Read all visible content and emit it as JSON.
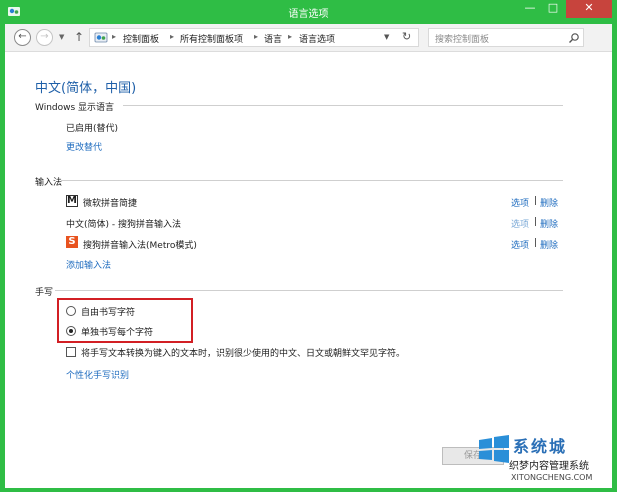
{
  "window": {
    "title": "语言选项",
    "minimize": "—",
    "maximize": "□",
    "close": "✕"
  },
  "address_bar": {
    "breadcrumbs": [
      "控制面板",
      "所有控制面板项",
      "语言",
      "语言选项"
    ],
    "search_placeholder": "搜索控制面板"
  },
  "page": {
    "heading": "中文(简体，中国)",
    "windows_display_language": {
      "title": "Windows 显示语言",
      "status": "已启用(替代)",
      "change_link": "更改替代"
    },
    "input_methods": {
      "title": "输入法",
      "items": [
        {
          "name": "微软拼音简捷",
          "icon": "M",
          "options": "选项",
          "separator": "|",
          "remove": "删除"
        },
        {
          "name": "中文(简体) - 搜狗拼音输入法",
          "icon": "",
          "options": "选项",
          "separator": "|",
          "remove": "删除"
        },
        {
          "name": "搜狗拼音输入法(Metro模式)",
          "icon": "S",
          "options": "选项",
          "separator": "|",
          "remove": "删除"
        }
      ],
      "add_link": "添加输入法"
    },
    "handwriting": {
      "title": "手写",
      "radio_free": "自由书写字符",
      "radio_single": "单独书写每个字符",
      "selected": "单独书写每个字符",
      "checkbox_label": "将手写文本转换为键入的文本时，识别很少使用的中文、日文或朝鲜文罕见字符。",
      "personalize_link": "个性化手写识别"
    },
    "save_button": "保存"
  },
  "watermark": {
    "title": "系统城",
    "subtitle": "织梦内容管理系统",
    "url": "XITONGCHENG.COM"
  },
  "colors": {
    "frame": "#2fbd45",
    "close": "#c7443d",
    "link": "#1f6cbf",
    "highlight": "#d21f24"
  }
}
